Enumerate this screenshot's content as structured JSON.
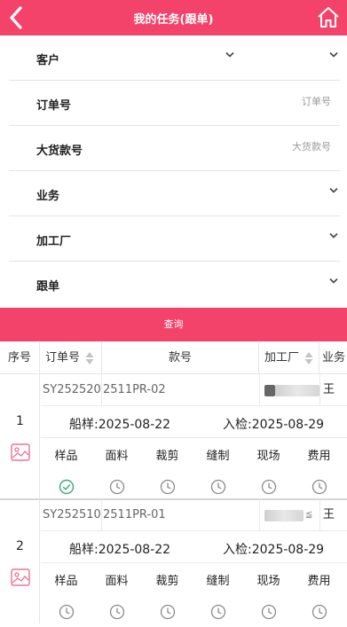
{
  "header": {
    "title": "我的任务(跟单)",
    "back_icon": "chevron-left-icon",
    "home_icon": "home-icon"
  },
  "form": {
    "customer": {
      "label": "客户"
    },
    "order_no": {
      "label": "订单号",
      "placeholder": "订单号"
    },
    "bulk_style": {
      "label": "大货款号",
      "placeholder": "大货款号"
    },
    "business": {
      "label": "业务"
    },
    "factory": {
      "label": "加工厂"
    },
    "follower": {
      "label": "跟单"
    }
  },
  "query_button": "查询",
  "table": {
    "headers": {
      "index": "序号",
      "order_no": "订单号",
      "style_no": "款号",
      "factory": "加工厂",
      "business": "业务"
    },
    "records": [
      {
        "index": "1",
        "order_no": "SY252520",
        "style_no": "2511PR-02",
        "business": "王",
        "ship_sample": "船样:2025-08-22",
        "inspection": "入检:2025-08-29",
        "steps": [
          {
            "label": "样品",
            "status": "done"
          },
          {
            "label": "面料",
            "status": "pending"
          },
          {
            "label": "裁剪",
            "status": "pending"
          },
          {
            "label": "缝制",
            "status": "pending"
          },
          {
            "label": "现场",
            "status": "pending"
          },
          {
            "label": "费用",
            "status": "pending"
          }
        ]
      },
      {
        "index": "2",
        "order_no": "SY252510",
        "style_no": "2511PR-01",
        "factory_suffix": "≦",
        "business": "王",
        "ship_sample": "船样:2025-08-22",
        "inspection": "入检:2025-08-29",
        "steps": [
          {
            "label": "样品",
            "status": "pending"
          },
          {
            "label": "面料",
            "status": "pending"
          },
          {
            "label": "裁剪",
            "status": "pending"
          },
          {
            "label": "缝制",
            "status": "pending"
          },
          {
            "label": "现场",
            "status": "pending"
          },
          {
            "label": "费用",
            "status": "pending"
          }
        ]
      }
    ]
  },
  "colors": {
    "accent": "#f4436a",
    "done": "#3aa977",
    "pending": "#8a8a8a"
  }
}
